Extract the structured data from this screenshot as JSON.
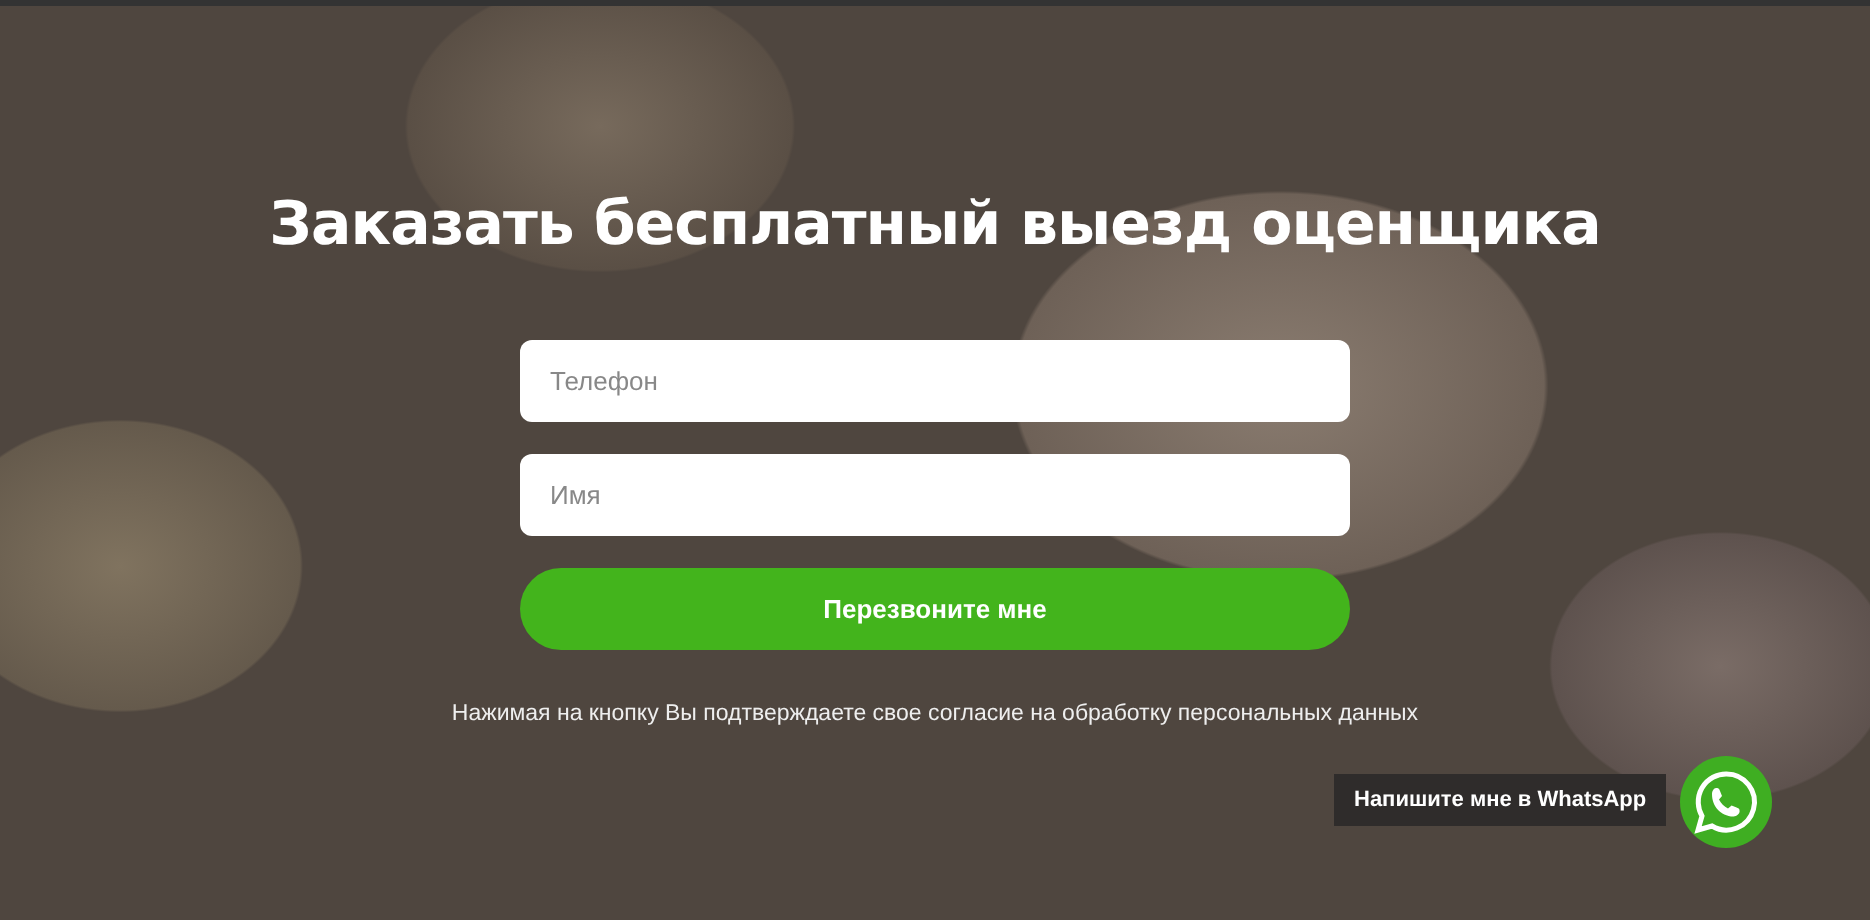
{
  "heading": "Заказать бесплатный выезд оценщика",
  "form": {
    "fields": [
      {
        "placeholder": "Телефон"
      },
      {
        "placeholder": "Имя"
      }
    ],
    "submit": "Перезвоните мне",
    "consent": "Нажимая на кнопку Вы подтверждаете свое согласие на обработку персональных данных"
  },
  "chat_widget": {
    "tooltip": "Напишите мне в WhatsApp"
  }
}
